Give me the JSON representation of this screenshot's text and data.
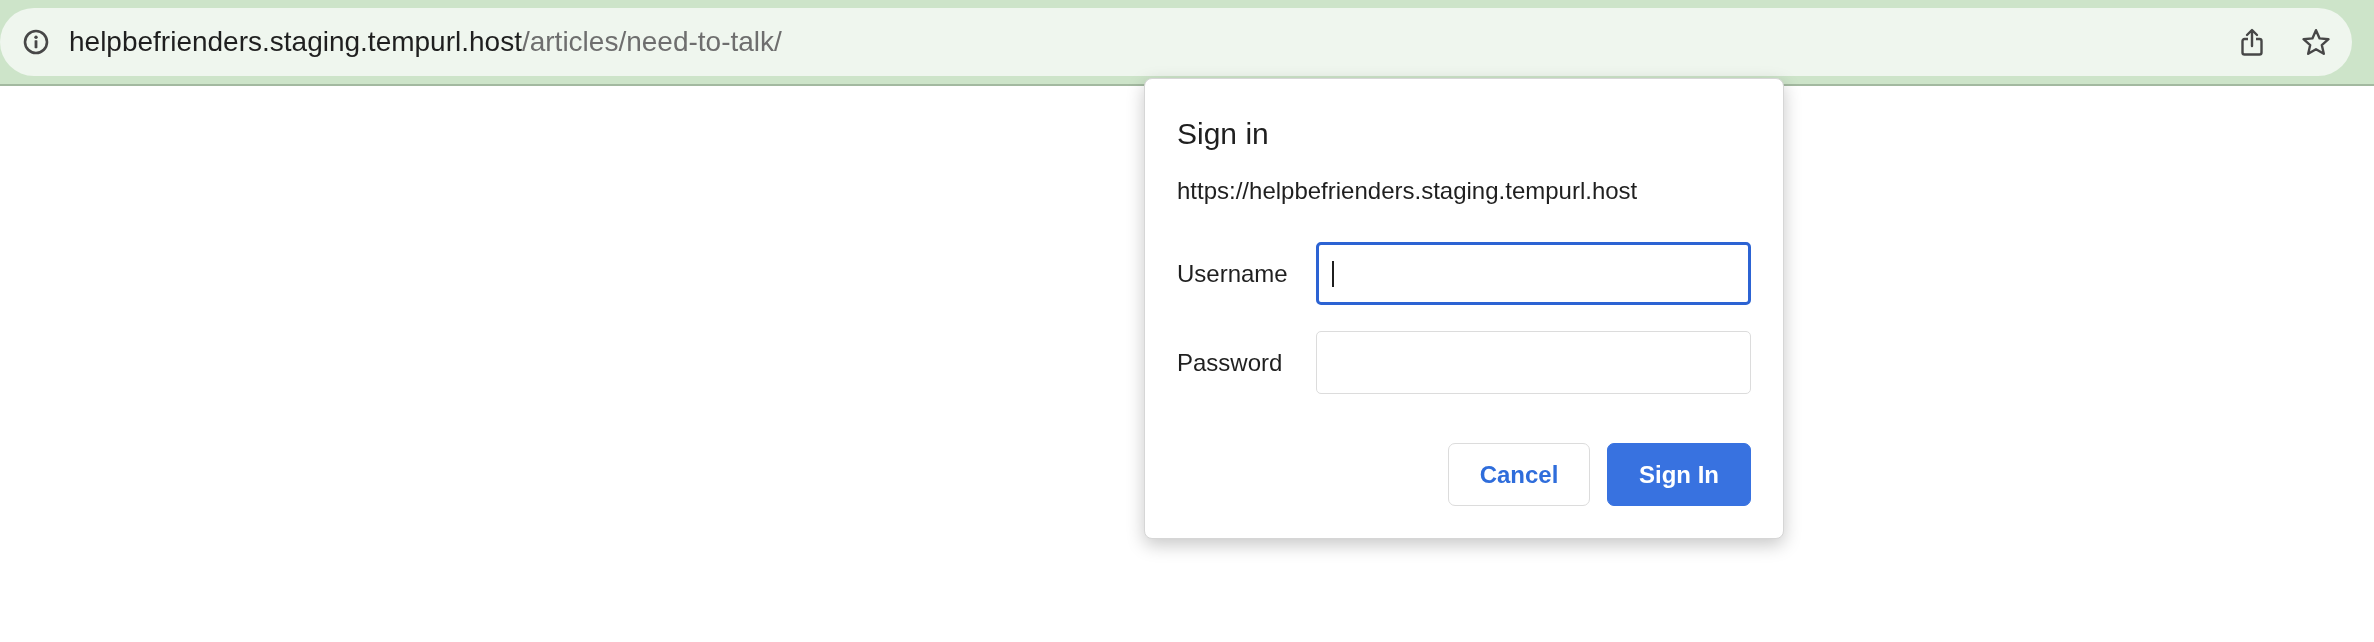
{
  "address_bar": {
    "host": "helpbefrienders.staging.tempurl.host",
    "path": "/articles/need-to-talk/"
  },
  "dialog": {
    "title": "Sign in",
    "origin": "https://helpbefrienders.staging.tempurl.host",
    "fields": [
      {
        "label": "Username",
        "focused": true
      },
      {
        "label": "Password",
        "focused": false
      }
    ],
    "buttons": [
      {
        "label": "Cancel",
        "kind": "cancel"
      },
      {
        "label": "Sign In",
        "kind": "submit"
      }
    ]
  }
}
